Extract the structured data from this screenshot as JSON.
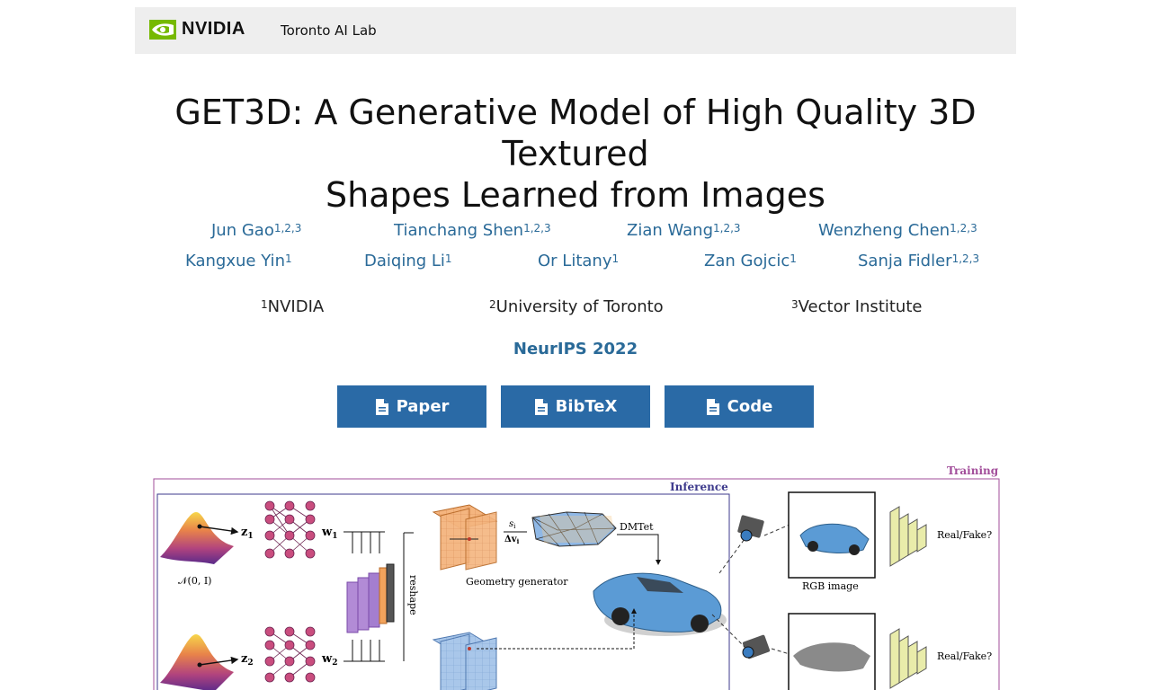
{
  "header": {
    "brand": "NVIDIA",
    "lab": "Toronto AI Lab"
  },
  "title": {
    "line1": "GET3D: A Generative Model of High Quality 3D Textured",
    "line2": "Shapes Learned from Images"
  },
  "authors": [
    {
      "name": "Jun Gao",
      "aff": "1,2,3"
    },
    {
      "name": "Tianchang Shen",
      "aff": "1,2,3"
    },
    {
      "name": "Zian Wang",
      "aff": "1,2,3"
    },
    {
      "name": "Wenzheng Chen",
      "aff": "1,2,3"
    },
    {
      "name": "Kangxue Yin",
      "aff": "1"
    },
    {
      "name": "Daiqing Li",
      "aff": "1"
    },
    {
      "name": "Or Litany",
      "aff": "1"
    },
    {
      "name": "Zan Gojcic",
      "aff": "1"
    },
    {
      "name": "Sanja Fidler",
      "aff": "1,2,3"
    }
  ],
  "institutions": [
    {
      "num": "1",
      "name": "NVIDIA"
    },
    {
      "num": "2",
      "name": "University of Toronto"
    },
    {
      "num": "3",
      "name": "Vector Institute"
    }
  ],
  "venue": "NeurIPS 2022",
  "buttons": [
    {
      "label": "Paper",
      "icon": "file-icon"
    },
    {
      "label": "BibTeX",
      "icon": "file-icon"
    },
    {
      "label": "Code",
      "icon": "file-icon"
    }
  ],
  "figure": {
    "training_label": "Training",
    "inference_label": "Inference",
    "z1": "z",
    "z1_sub": "1",
    "w1": "w",
    "w1_sub": "1",
    "z2": "z",
    "z2_sub": "2",
    "w2": "w",
    "w2_sub": "2",
    "normal_dist": "𝒩(0, I)",
    "reshape": "reshape",
    "geometry_generator": "Geometry generator",
    "si": "s",
    "si_sub": "i",
    "dv": "Δv",
    "dv_sub": "i",
    "dmtet": "DMTet",
    "rgb_image": "RGB image",
    "real_fake_1": "Real/Fake?",
    "real_fake_2": "Real/Fake?"
  }
}
